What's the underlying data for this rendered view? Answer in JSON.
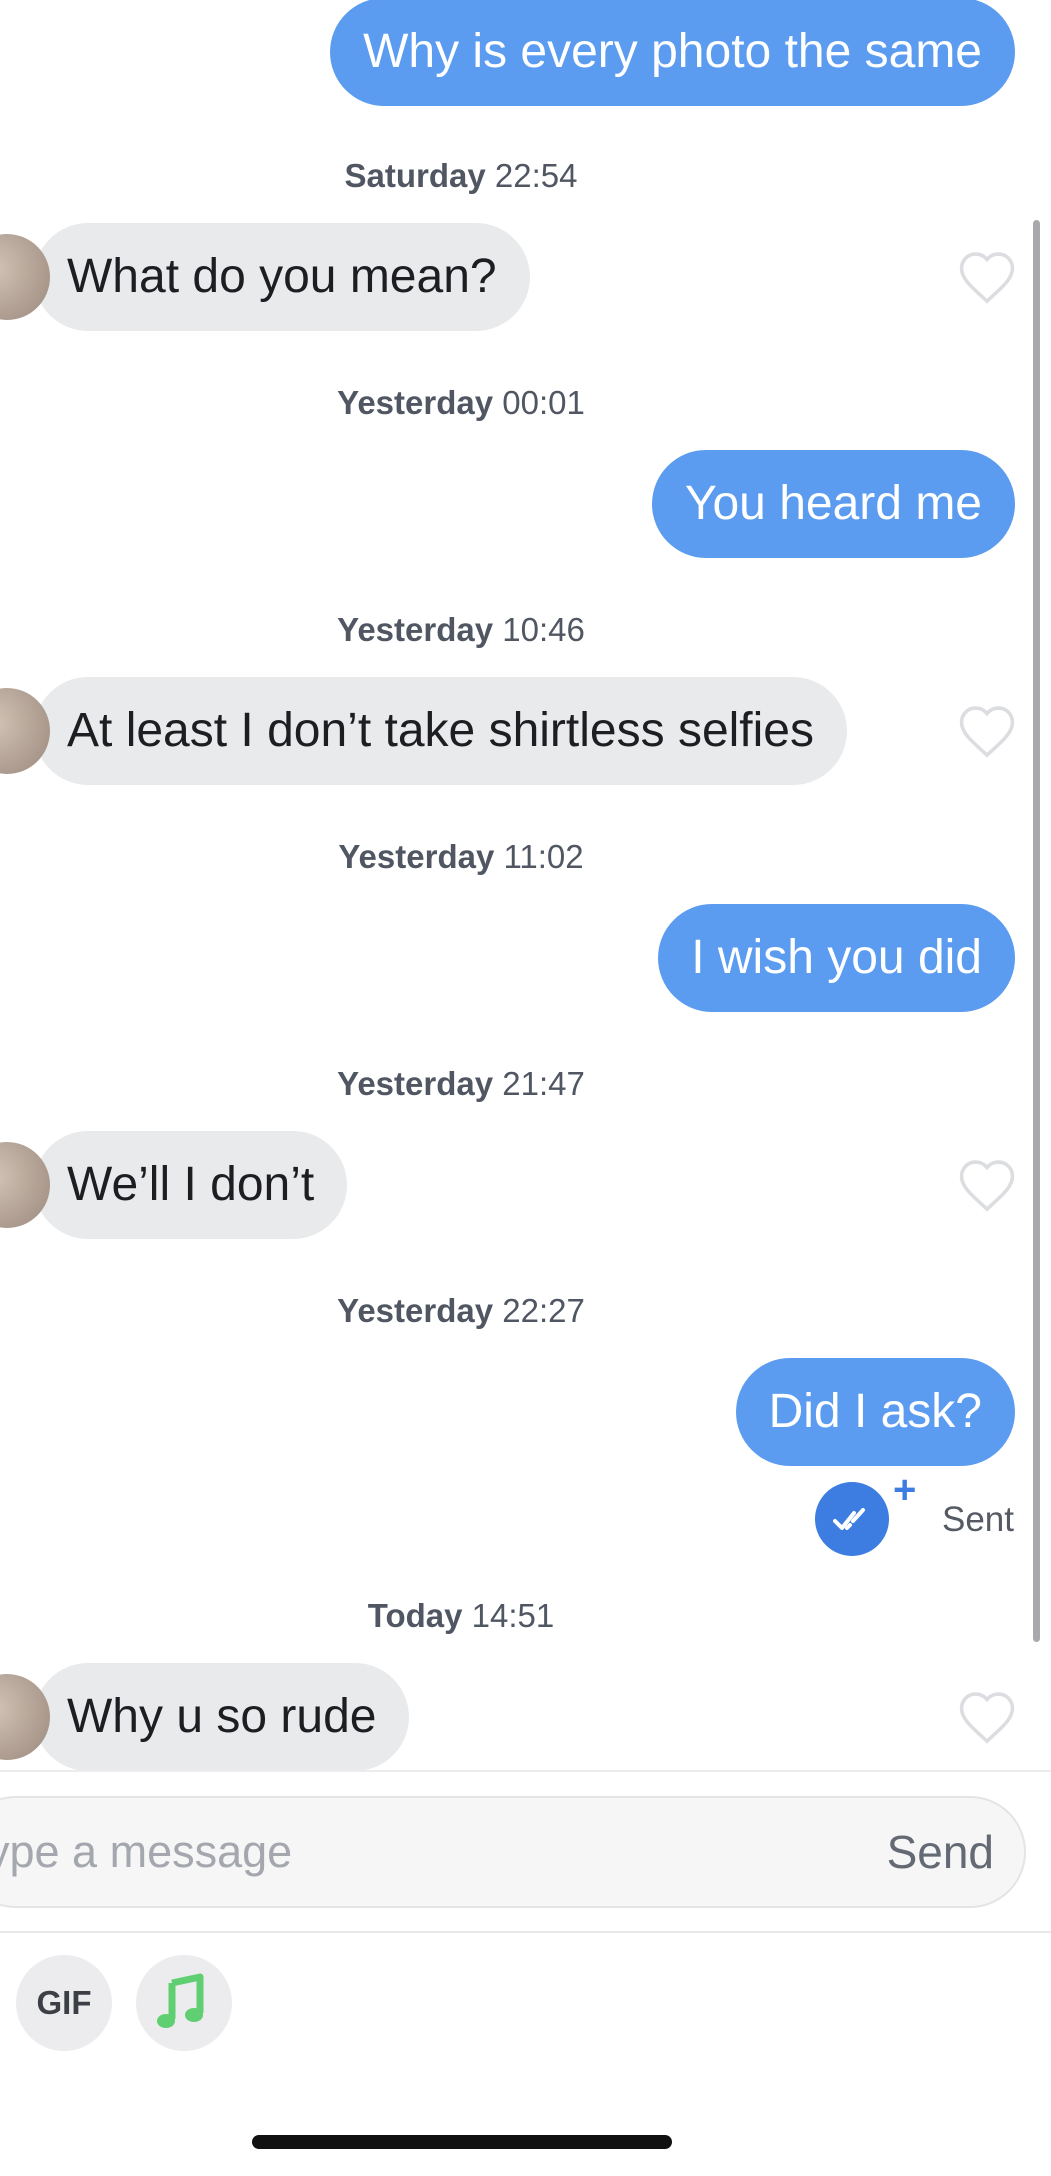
{
  "thread": {
    "messages": [
      {
        "type": "sent",
        "text": "Why is every photo the same"
      },
      {
        "type": "timestamp",
        "day": "Saturday",
        "time": "22:54"
      },
      {
        "type": "received",
        "text": "What do you mean?"
      },
      {
        "type": "timestamp",
        "day": "Yesterday",
        "time": "00:01"
      },
      {
        "type": "sent",
        "text": "You heard me"
      },
      {
        "type": "timestamp",
        "day": "Yesterday",
        "time": "10:46"
      },
      {
        "type": "received",
        "text": "At least I don’t take shirtless selfies"
      },
      {
        "type": "timestamp",
        "day": "Yesterday",
        "time": "11:02"
      },
      {
        "type": "sent",
        "text": "I wish you did"
      },
      {
        "type": "timestamp",
        "day": "Yesterday",
        "time": "21:47"
      },
      {
        "type": "received",
        "text": "We’ll I don’t"
      },
      {
        "type": "timestamp",
        "day": "Yesterday",
        "time": "22:27"
      },
      {
        "type": "sent",
        "text": "Did I ask?"
      },
      {
        "type": "timestamp",
        "day": "Today",
        "time": "14:51"
      },
      {
        "type": "received",
        "text": "Why u so rude"
      }
    ],
    "status": {
      "label": "Sent",
      "plus": "+",
      "icon": "double-check-icon"
    }
  },
  "composer": {
    "placeholder": "Type a message",
    "send_label": "Send"
  },
  "tray": {
    "gif_label": "GIF",
    "music_icon": "music-note-icon"
  },
  "colors": {
    "sent_bubble": "#5b9cf0",
    "received_bubble": "#e9eaec",
    "accent": "#3d7de2",
    "music": "#5fcf71"
  }
}
